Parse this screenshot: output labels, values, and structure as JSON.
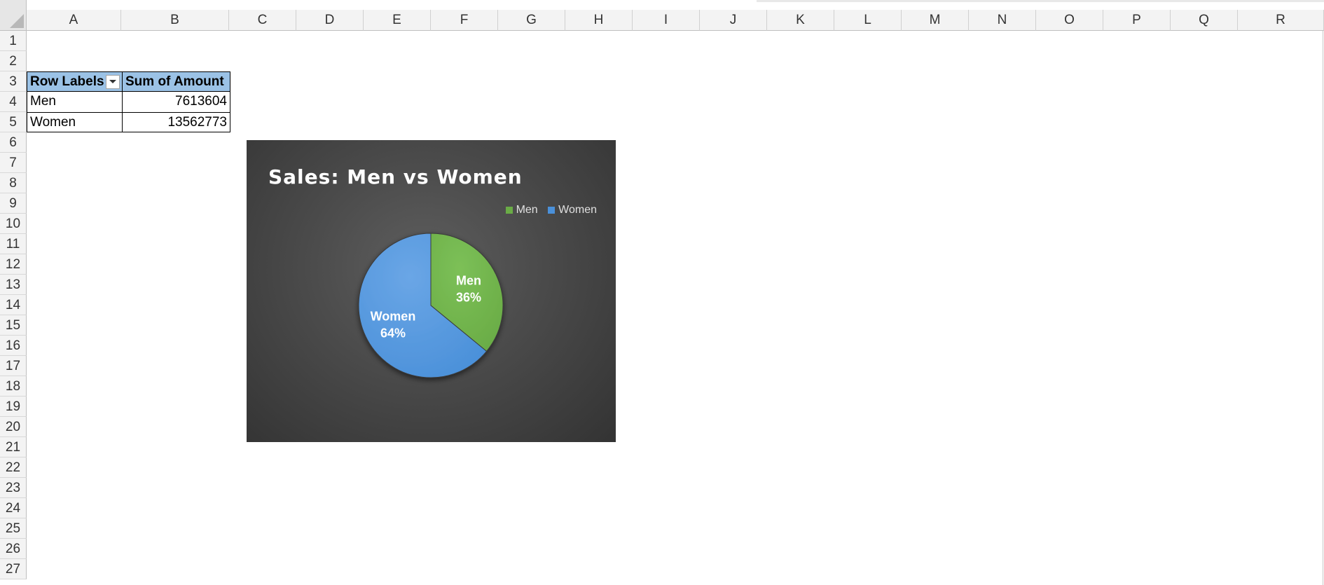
{
  "columns": [
    "A",
    "B",
    "C",
    "D",
    "E",
    "F",
    "G",
    "H",
    "I",
    "J",
    "K",
    "L",
    "M",
    "N",
    "O",
    "P",
    "Q",
    "R"
  ],
  "rows": [
    "1",
    "2",
    "3",
    "4",
    "5",
    "6",
    "7",
    "8",
    "9",
    "10",
    "11",
    "12",
    "13",
    "14",
    "15",
    "16",
    "17",
    "18",
    "19",
    "20",
    "21",
    "22",
    "23",
    "24",
    "25",
    "26",
    "27"
  ],
  "pivot": {
    "header_row_labels": "Row Labels",
    "header_sum": "Sum of Amount",
    "rows": [
      {
        "label": "Men",
        "value": "7613604"
      },
      {
        "label": "Women",
        "value": "13562773"
      }
    ]
  },
  "chart_data": {
    "type": "pie",
    "title": "Sales: Men vs Women",
    "categories": [
      "Men",
      "Women"
    ],
    "values": [
      7613604,
      13562773
    ],
    "percent_labels": [
      "36%",
      "64%"
    ],
    "colors": [
      "#6aac46",
      "#4a90d9"
    ],
    "legend": "top-right",
    "background": "#4a4a4a"
  }
}
